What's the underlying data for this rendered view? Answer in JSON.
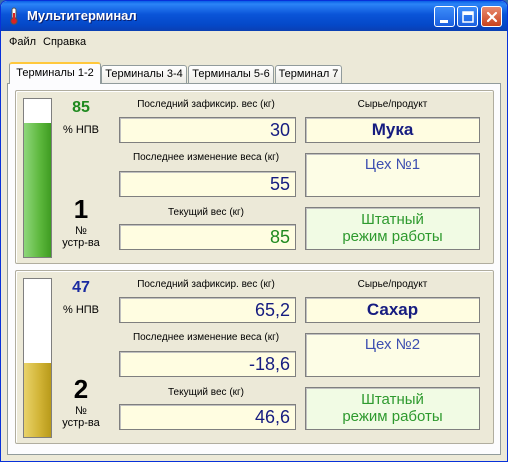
{
  "window": {
    "title": "Мультитерминал"
  },
  "menu": {
    "file": "Файл",
    "help": "Справка"
  },
  "tabs": [
    {
      "label": "Терминалы 1-2",
      "active": true
    },
    {
      "label": "Терминалы 3-4",
      "active": false
    },
    {
      "label": "Терминалы 5-6",
      "active": false
    },
    {
      "label": "Терминал 7",
      "active": false
    }
  ],
  "labels": {
    "pct_unit": "% НПВ",
    "device_no": "№",
    "device_word": "устр-ва",
    "last_fixed_weight": "Последний зафиксир. вес (кг)",
    "last_change": "Последнее изменение веса (кг)",
    "current_weight": "Текущий вес (кг)",
    "raw_material": "Сырье/продукт"
  },
  "devices": [
    {
      "number": "1",
      "percent": "85",
      "fill_fraction": 0.85,
      "last_fixed_weight": "30",
      "last_change": "55",
      "current_weight": "85",
      "product": "Мука",
      "shop": "Цех №1",
      "mode_line1": "Штатный",
      "mode_line2": "режим работы",
      "colors": {
        "fill": "#5cb73c",
        "percent_text": "#1f8a1f"
      }
    },
    {
      "number": "2",
      "percent": "47",
      "fill_fraction": 0.47,
      "last_fixed_weight": "65,2",
      "last_change": "-18,6",
      "current_weight": "46,6",
      "product": "Сахар",
      "shop": "Цех №2",
      "mode_line1": "Штатный",
      "mode_line2": "режим работы",
      "colors": {
        "fill": "#d0b234",
        "percent_text": "#1a2aa0"
      }
    }
  ],
  "icons": {
    "app": "thermometer-icon",
    "minimize": "minimize-icon",
    "maximize": "maximize-icon",
    "close": "close-icon"
  }
}
